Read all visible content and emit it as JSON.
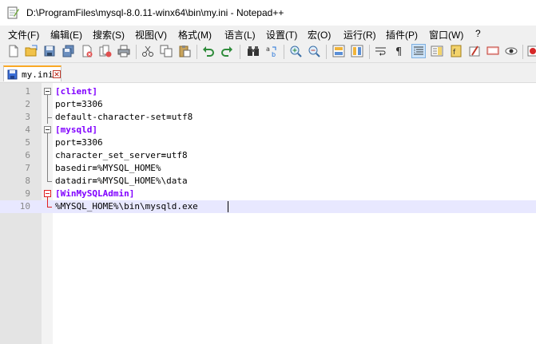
{
  "window": {
    "title": "D:\\ProgramFiles\\mysql-8.0.11-winx64\\bin\\my.ini - Notepad++",
    "icon": "notepad-icon"
  },
  "menu": [
    {
      "id": "file",
      "label": "文件(F)"
    },
    {
      "id": "edit",
      "label": "编辑(E)"
    },
    {
      "id": "search",
      "label": "搜索(S)"
    },
    {
      "id": "view",
      "label": "视图(V)"
    },
    {
      "id": "format",
      "label": "格式(M)"
    },
    {
      "id": "language",
      "label": "语言(L)"
    },
    {
      "id": "settings",
      "label": "设置(T)"
    },
    {
      "id": "macro",
      "label": "宏(O)"
    },
    {
      "id": "run",
      "label": "运行(R)"
    },
    {
      "id": "plugins",
      "label": "插件(P)"
    },
    {
      "id": "window",
      "label": "窗口(W)"
    },
    {
      "id": "help",
      "label": "?"
    }
  ],
  "toolbar": [
    "new-file-icon",
    "open-file-icon",
    "save-icon",
    "save-all-icon",
    "close-icon",
    "close-all-icon",
    "print-icon",
    "cut-icon",
    "copy-icon",
    "paste-icon",
    "undo-icon",
    "redo-icon",
    "find-icon",
    "replace-icon",
    "zoom-in-icon",
    "zoom-out-icon",
    "sync-vertical-icon",
    "sync-horizontal-icon",
    "word-wrap-icon",
    "show-all-chars-icon",
    "indent-guide-icon",
    "doc-map-icon",
    "function-list-icon",
    "folder-workspace-icon",
    "monitor-icon",
    "preview-icon",
    "record-macro-icon"
  ],
  "tab": {
    "label": "my.ini",
    "icon": "file-saved-icon",
    "close_icon": "tab-close-icon"
  },
  "editor": {
    "lines": [
      {
        "n": "1",
        "type": "section",
        "text": "[client]"
      },
      {
        "n": "2",
        "type": "kv",
        "key": "port",
        "value": "3306"
      },
      {
        "n": "3",
        "type": "kv",
        "key": "default-character-set",
        "value": "utf8"
      },
      {
        "n": "4",
        "type": "section",
        "text": "[mysqld]"
      },
      {
        "n": "5",
        "type": "kv",
        "key": "port",
        "value": "3306"
      },
      {
        "n": "6",
        "type": "kv",
        "key": "character_set_server",
        "value": "utf8"
      },
      {
        "n": "7",
        "type": "kv",
        "key": "basedir",
        "value": "%MYSQL_HOME%"
      },
      {
        "n": "8",
        "type": "kv",
        "key": "datadir",
        "value": "%MYSQL_HOME%\\data"
      },
      {
        "n": "9",
        "type": "section",
        "text": "[WinMySQLAdmin]"
      },
      {
        "n": "10",
        "type": "plain",
        "text": "%MYSQL_HOME%\\bin\\mysqld.exe"
      }
    ],
    "current_line": 10
  }
}
